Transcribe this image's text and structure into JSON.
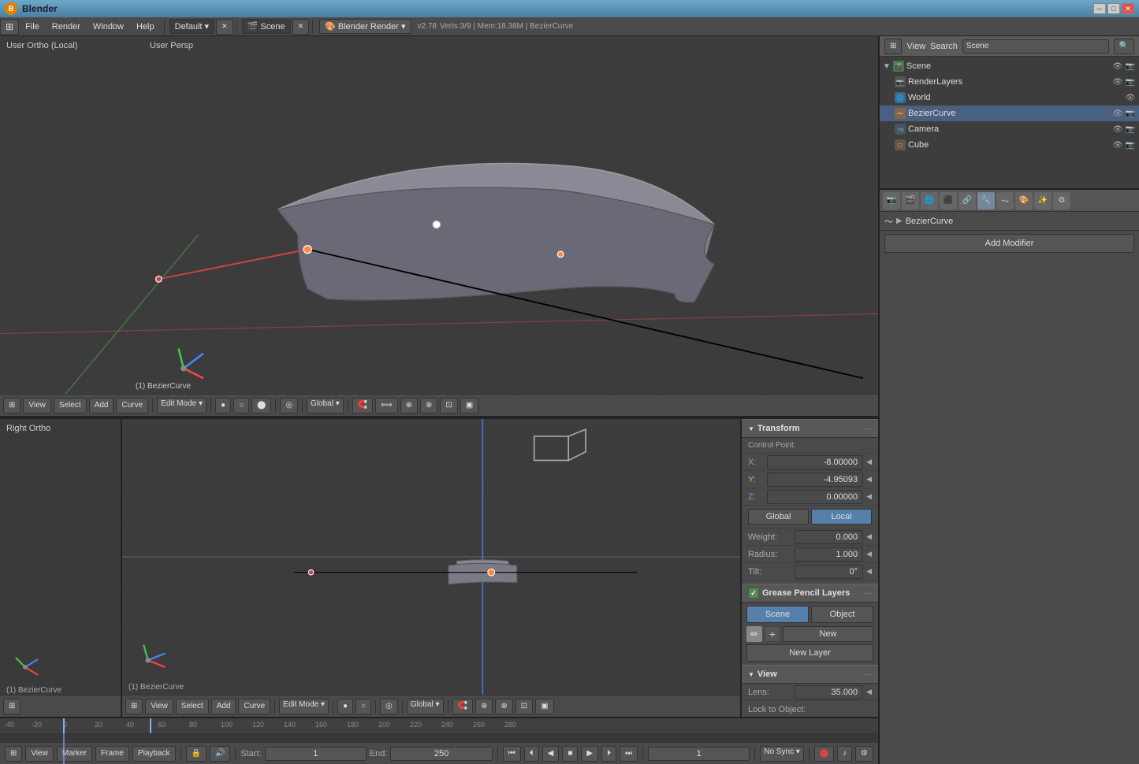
{
  "app": {
    "title": "Blender",
    "version": "v2.78",
    "stats": "Verts:3/9 | Mem:18.38M | BezierCurve"
  },
  "titlebar": {
    "title": "Blender",
    "minimize": "─",
    "maximize": "□",
    "close": "✕"
  },
  "menubar": {
    "items": [
      "File",
      "Render",
      "Window",
      "Help"
    ],
    "workspace": "Default",
    "scene": "Scene",
    "engine": "Blender Render"
  },
  "viewport_top": {
    "label_left": "User Ortho (Local)",
    "label_right": "User Persp",
    "object_label": "(1) BezierCurve"
  },
  "viewport_bottom_left": {
    "label": "Right Ortho",
    "object_label": "(1) BezierCurve"
  },
  "viewport_bottom_right": {
    "object_label": "(1) BezierCurve"
  },
  "toolbar_top": {
    "view": "View",
    "select": "Select",
    "add": "Add",
    "curve": "Curve",
    "mode": "Edit Mode",
    "shading": "●",
    "pivot": "◎",
    "transform": "Global"
  },
  "outliner": {
    "title": "Scene",
    "search_placeholder": "Search",
    "items": [
      {
        "label": "Scene",
        "level": 0,
        "icon": "🎬",
        "expanded": true
      },
      {
        "label": "RenderLayers",
        "level": 1,
        "icon": "📷"
      },
      {
        "label": "World",
        "level": 1,
        "icon": "🌐"
      },
      {
        "label": "BezierCurve",
        "level": 1,
        "icon": "〜",
        "selected": true
      },
      {
        "label": "Camera",
        "level": 1,
        "icon": "📹"
      },
      {
        "label": "Cube",
        "level": 1,
        "icon": "□"
      }
    ]
  },
  "properties": {
    "breadcrumb": "BezierCurve",
    "add_modifier_label": "Add Modifier"
  },
  "transform": {
    "title": "Transform",
    "control_point": "Control Point:",
    "x_label": "X:",
    "x_value": "-8.00000",
    "y_label": "Y:",
    "y_value": "-4.95093",
    "z_label": "Z:",
    "z_value": "0.00000",
    "global_btn": "Global",
    "local_btn": "Local",
    "weight_label": "Weight:",
    "weight_value": "0.000",
    "radius_label": "Radius:",
    "radius_value": "1.000",
    "tilt_label": "Tilt:",
    "tilt_value": "0°"
  },
  "grease_pencil": {
    "title": "Grease Pencil Layers",
    "scene_btn": "Scene",
    "object_btn": "Object",
    "new_btn": "New",
    "new_layer_btn": "New Layer"
  },
  "view_section": {
    "title": "View",
    "lens_label": "Lens:",
    "lens_value": "35.000",
    "lock_label": "Lock to Object:"
  },
  "timeline": {
    "start_label": "Start:",
    "start_value": "1",
    "end_label": "End:",
    "end_value": "250",
    "current_frame": "1",
    "sync": "No Sync",
    "ticks": [
      "-40",
      "-20",
      "0",
      "20",
      "40",
      "60",
      "80",
      "100",
      "120",
      "140",
      "160",
      "180",
      "200",
      "220",
      "240",
      "260",
      "280"
    ]
  },
  "statusbar": {
    "mode": "Edit Mode",
    "info": "Global"
  }
}
